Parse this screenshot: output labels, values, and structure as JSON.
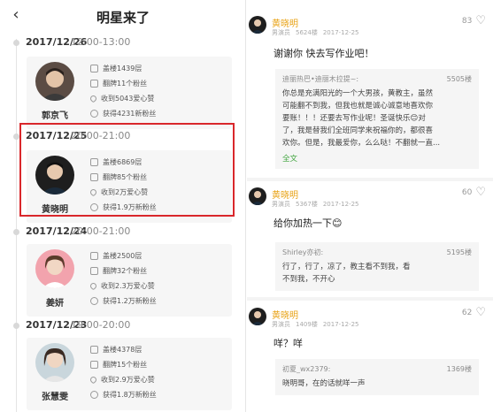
{
  "left": {
    "nav": {
      "back_icon": "chevron-left-icon",
      "title": "明星来了"
    },
    "entries": [
      {
        "date": "2017/12/26",
        "time": "12:00-13:00",
        "name": "郭京飞",
        "stats": [
          "盖楼1439层",
          "翻牌11个粉丝",
          "收到5043爱心赞",
          "获得4231新粉丝"
        ]
      },
      {
        "date": "2017/12/25",
        "time": "20:00-21:00",
        "name": "黄晓明",
        "stats": [
          "盖楼6869层",
          "翻牌85个粉丝",
          "收到2万爱心赞",
          "获得1.9万新粉丝"
        ]
      },
      {
        "date": "2017/12/24",
        "time": "20:00-21:00",
        "name": "姜妍",
        "stats": [
          "盖楼2500层",
          "翻牌32个粉丝",
          "收到2.3万爱心赞",
          "获得1.2万新粉丝"
        ]
      },
      {
        "date": "2017/12/23",
        "time": "19:00-20:00",
        "name": "张慧雯",
        "stats": [
          "盖楼4378层",
          "翻牌15个粉丝",
          "收到2.9万爱心赞",
          "获得1.8万新粉丝"
        ]
      }
    ]
  },
  "right": {
    "comments": [
      {
        "name": "黄晓明",
        "role": "男演员",
        "floor": "5624楼",
        "date": "2017-12-25",
        "likes": "83",
        "text": "谢谢你 快去写作业吧！",
        "quote": {
          "author": "迪丽热巴•迪丽木拉提~:",
          "floor": "5505楼",
          "lines": [
            "你总是充满阳光的一个大男孩，黄教主，虽然",
            "可能翻不到我，但我也就是诚心诚意地喜欢你",
            "要账！！！还要去写作业呢！圣诞快乐😊对",
            "了，我是替我们全班同学来祝福你的，都很喜",
            "欢你。但是，我最爱你，么么哒！不翻就一直..."
          ],
          "more": "全文"
        }
      },
      {
        "name": "黄晓明",
        "role": "男演员",
        "floor": "5367楼",
        "date": "2017-12-25",
        "likes": "60",
        "text": "给你加热一下😊",
        "quote": {
          "author": "Shirley亦初:",
          "floor": "5195楼",
          "lines": [
            "行了，行了，凉了，教主看不到我，看",
            "不到我，不开心"
          ],
          "more": ""
        }
      },
      {
        "name": "黄晓明",
        "role": "男演员",
        "floor": "1409楼",
        "date": "2017-12-25",
        "likes": "62",
        "text": "咩？咩",
        "quote": {
          "author": "初夏_wx2379:",
          "floor": "1369楼",
          "lines": [
            "晓明哥，在的话就咩一声"
          ],
          "more": ""
        }
      }
    ]
  },
  "colors": {
    "accent_name": "#e8a317",
    "highlight": "#d9272b",
    "link": "#3ca33a"
  }
}
